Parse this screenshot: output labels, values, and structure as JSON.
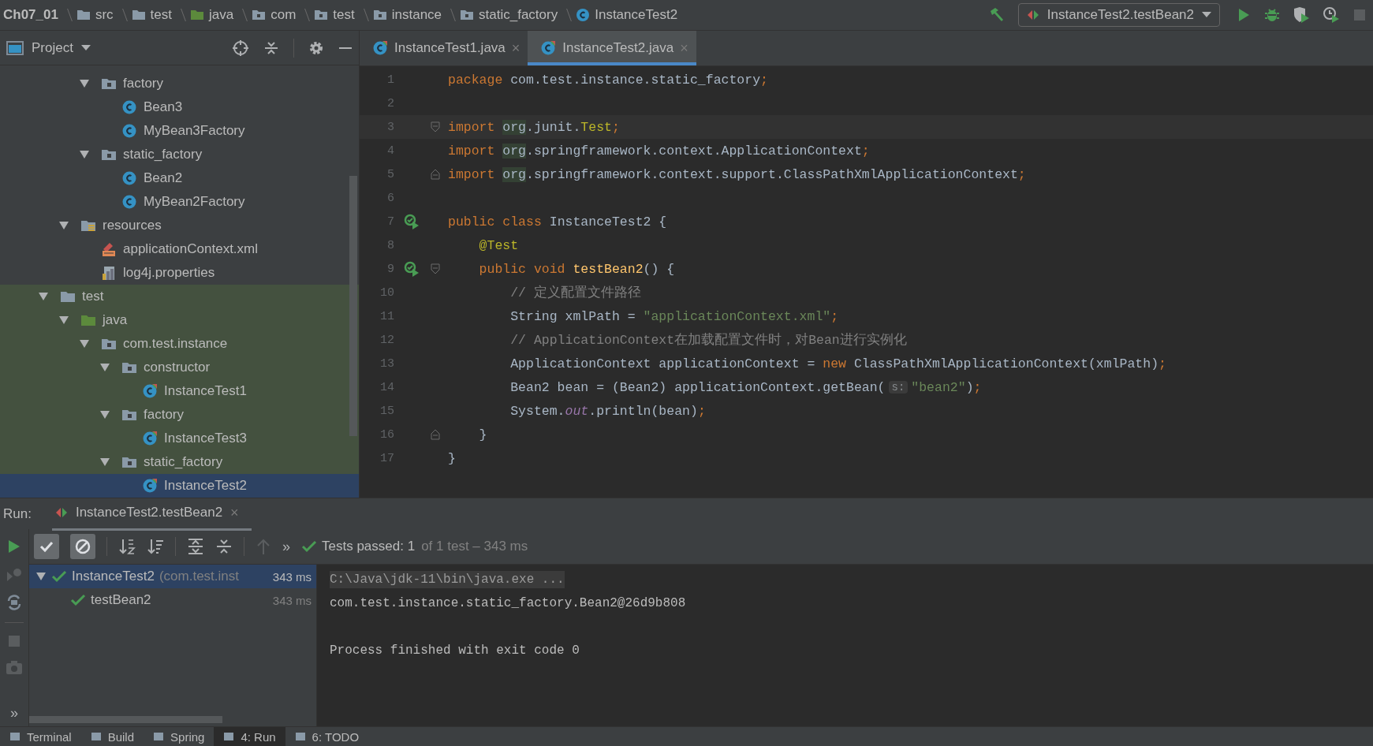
{
  "breadcrumbs": [
    {
      "label": "Ch07_01",
      "kind": "project"
    },
    {
      "label": "src",
      "kind": "folder"
    },
    {
      "label": "test",
      "kind": "folder"
    },
    {
      "label": "java",
      "kind": "source"
    },
    {
      "label": "com",
      "kind": "package"
    },
    {
      "label": "test",
      "kind": "package"
    },
    {
      "label": "instance",
      "kind": "package"
    },
    {
      "label": "static_factory",
      "kind": "package"
    },
    {
      "label": "InstanceTest2",
      "kind": "class"
    }
  ],
  "run_config": {
    "label": "InstanceTest2.testBean2"
  },
  "project_panel": {
    "title": "Project"
  },
  "tree": {
    "items": [
      {
        "children": [
          {
            "children": [
              {
                "label": "factory",
                "kind": "package",
                "expanded": true,
                "selected": false,
                "children": [
                  {
                    "label": "Bean3",
                    "kind": "class",
                    "selected": false
                  },
                  {
                    "label": "MyBean3Factory",
                    "kind": "class",
                    "selected": false
                  }
                ]
              },
              {
                "label": "static_factory",
                "kind": "package",
                "expanded": true,
                "selected": false,
                "children": [
                  {
                    "label": "Bean2",
                    "kind": "class",
                    "selected": false
                  },
                  {
                    "label": "MyBean2Factory",
                    "kind": "class",
                    "selected": false
                  }
                ]
              }
            ]
          },
          {
            "label": "resources",
            "kind": "resources",
            "expanded": true,
            "selected": false,
            "children": [
              {
                "label": "applicationContext.xml",
                "kind": "xml",
                "selected": false
              },
              {
                "label": "log4j.properties",
                "kind": "properties",
                "selected": false
              }
            ]
          }
        ]
      },
      {
        "label": "test",
        "kind": "folder",
        "expanded": true,
        "selected": false,
        "test_source": true,
        "children": [
          {
            "label": "java",
            "kind": "source",
            "expanded": true,
            "selected": false,
            "children": [
              {
                "label": "com.test.instance",
                "kind": "package",
                "expanded": true,
                "selected": false,
                "children": [
                  {
                    "label": "constructor",
                    "kind": "package",
                    "expanded": true,
                    "selected": false,
                    "children": [
                      {
                        "label": "InstanceTest1",
                        "kind": "testclass",
                        "selected": false
                      }
                    ]
                  },
                  {
                    "label": "factory",
                    "kind": "package",
                    "expanded": true,
                    "selected": false,
                    "children": [
                      {
                        "label": "InstanceTest3",
                        "kind": "testclass",
                        "selected": false
                      }
                    ]
                  },
                  {
                    "label": "static_factory",
                    "kind": "package",
                    "expanded": true,
                    "selected": false,
                    "children": [
                      {
                        "label": "InstanceTest2",
                        "kind": "testclass",
                        "selected": true
                      }
                    ]
                  }
                ]
              }
            ]
          }
        ]
      }
    ]
  },
  "editor_tabs": [
    {
      "label": "InstanceTest1.java",
      "close": "×",
      "selected": false
    },
    {
      "label": "InstanceTest2.java",
      "close": "×",
      "selected": true
    }
  ],
  "code_lines": [
    {
      "number": "1",
      "current": false,
      "run_icon": false,
      "tokens": [
        {
          "kind": "keyword",
          "text": "package "
        },
        {
          "kind": "plain",
          "text": "com.test.instance.static_factory"
        },
        {
          "kind": "keyword",
          "text": ";"
        }
      ]
    },
    {
      "number": "2",
      "current": false,
      "run_icon": false
    },
    {
      "number": "3",
      "current": true,
      "run_icon": false,
      "fold_start": true,
      "tokens": [
        {
          "kind": "keyword",
          "text": "import "
        },
        {
          "kind": "marked",
          "text": "org"
        },
        {
          "kind": "plain",
          "text": ".junit."
        },
        {
          "kind": "annotation",
          "text": "Test"
        },
        {
          "kind": "keyword",
          "text": ";"
        }
      ]
    },
    {
      "number": "4",
      "current": false,
      "run_icon": false,
      "tokens": [
        {
          "kind": "keyword",
          "text": "import "
        },
        {
          "kind": "marked",
          "text": "org"
        },
        {
          "kind": "plain",
          "text": ".springframework.context.ApplicationContext"
        },
        {
          "kind": "keyword",
          "text": ";"
        }
      ]
    },
    {
      "number": "5",
      "current": false,
      "run_icon": false,
      "fold_end": true,
      "tokens": [
        {
          "kind": "keyword",
          "text": "import "
        },
        {
          "kind": "marked",
          "text": "org"
        },
        {
          "kind": "plain",
          "text": ".springframework.context.support.ClassPathXmlApplicationContext"
        },
        {
          "kind": "keyword",
          "text": ";"
        }
      ]
    },
    {
      "number": "6",
      "current": false,
      "run_icon": false
    },
    {
      "number": "7",
      "current": false,
      "run_icon": true,
      "tokens": [
        {
          "kind": "keyword",
          "text": "public class "
        },
        {
          "kind": "plain",
          "text": "InstanceTest2 {"
        }
      ]
    },
    {
      "number": "8",
      "current": false,
      "run_icon": false,
      "tokens": [
        {
          "kind": "annotation",
          "text": "    @Test"
        }
      ]
    },
    {
      "number": "9",
      "current": false,
      "run_icon": true,
      "fold_start": true,
      "tokens": [
        {
          "kind": "keyword",
          "text": "    public void "
        },
        {
          "kind": "method",
          "text": "testBean2"
        },
        {
          "kind": "plain",
          "text": "() {"
        }
      ]
    },
    {
      "number": "10",
      "current": false,
      "run_icon": false,
      "tokens": [
        {
          "kind": "comment",
          "text": "        // 定义配置文件路径"
        }
      ]
    },
    {
      "number": "11",
      "current": false,
      "run_icon": false,
      "tokens": [
        {
          "kind": "plain",
          "text": "        String xmlPath = "
        },
        {
          "kind": "string",
          "text": "\"applicationContext.xml\""
        },
        {
          "kind": "keyword",
          "text": ";"
        }
      ]
    },
    {
      "number": "12",
      "current": false,
      "run_icon": false,
      "tokens": [
        {
          "kind": "comment",
          "text": "        // ApplicationContext在加载配置文件时，对Bean进行实例化"
        }
      ]
    },
    {
      "number": "13",
      "current": false,
      "run_icon": false,
      "tokens": [
        {
          "kind": "plain",
          "text": "        ApplicationContext applicationContext = "
        },
        {
          "kind": "keyword",
          "text": "new "
        },
        {
          "kind": "plain",
          "text": "ClassPathXmlApplicationContext(xmlPath)"
        },
        {
          "kind": "keyword",
          "text": ";"
        }
      ]
    },
    {
      "number": "14",
      "current": false,
      "run_icon": false,
      "tokens": [
        {
          "kind": "plain",
          "text": "        Bean2 bean = (Bean2) applicationContext.getBean("
        },
        {
          "kind": "hint",
          "text": "s:"
        },
        {
          "kind": "string",
          "text": "\"bean2\""
        },
        {
          "kind": "plain",
          "text": ")"
        },
        {
          "kind": "keyword",
          "text": ";"
        }
      ]
    },
    {
      "number": "15",
      "current": false,
      "run_icon": false,
      "tokens": [
        {
          "kind": "plain",
          "text": "        System."
        },
        {
          "kind": "static",
          "text": "out"
        },
        {
          "kind": "plain",
          "text": ".println(bean)"
        },
        {
          "kind": "keyword",
          "text": ";"
        }
      ]
    },
    {
      "number": "16",
      "current": false,
      "run_icon": false,
      "fold_end": true,
      "tokens": [
        {
          "kind": "plain",
          "text": "    }"
        }
      ]
    },
    {
      "number": "17",
      "current": false,
      "run_icon": false,
      "tokens": [
        {
          "kind": "plain",
          "text": "}"
        }
      ]
    }
  ],
  "run_panel": {
    "label": "Run:",
    "tab": {
      "label": "InstanceTest2.testBean2",
      "close": "×"
    },
    "show_passed": true,
    "show_ignored": true,
    "more": "»",
    "status": {
      "label": "Tests passed: 1",
      "detail": "of 1 test – 343 ms"
    },
    "tests": [
      {
        "name": "InstanceTest2",
        "detail": "(com.test.inst",
        "time": "343 ms",
        "passed": true,
        "expanded": true,
        "selected": true,
        "children": [
          {
            "name": "testBean2",
            "time": "343 ms",
            "passed": true,
            "selected": false
          }
        ]
      }
    ],
    "console": [
      {
        "kind": "command",
        "text": "C:\\Java\\jdk-11\\bin\\java.exe ..."
      },
      {
        "kind": "output",
        "text": "com.test.instance.static_factory.Bean2@26d9b808"
      },
      {
        "kind": "blank"
      },
      {
        "kind": "output",
        "text": "Process finished with exit code 0"
      }
    ],
    "side_more": "»"
  },
  "tool_strip": [
    {
      "label": "Terminal",
      "selected": false
    },
    {
      "label": "Build",
      "selected": false
    },
    {
      "label": "Spring",
      "selected": false
    },
    {
      "label": "4: Run",
      "selected": true
    },
    {
      "label": "6: TODO",
      "selected": false
    }
  ]
}
